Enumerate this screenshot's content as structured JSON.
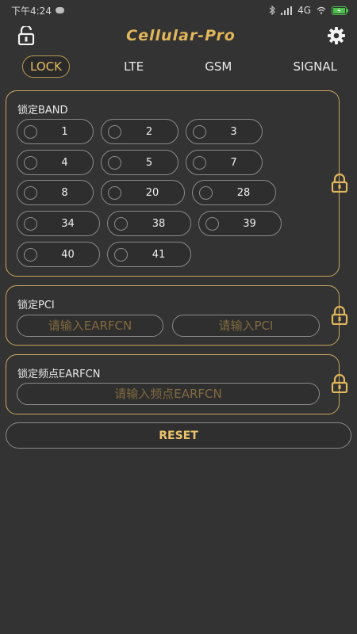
{
  "status_bar": {
    "time": "下午4:24",
    "network": "4G"
  },
  "app": {
    "title": "Cellular-Pro"
  },
  "tabs": [
    {
      "label": "LOCK",
      "active": true
    },
    {
      "label": "LTE",
      "active": false
    },
    {
      "label": "GSM",
      "active": false
    },
    {
      "label": "SIGNAL",
      "active": false
    }
  ],
  "band_section": {
    "title": "锁定BAND",
    "bands": [
      "1",
      "2",
      "3",
      "4",
      "5",
      "7",
      "8",
      "20",
      "28",
      "34",
      "38",
      "39",
      "40",
      "41"
    ]
  },
  "pci_section": {
    "title": "锁定PCI",
    "earfcn_placeholder": "请输入EARFCN",
    "pci_placeholder": "请输入PCI"
  },
  "earfcn_section": {
    "title": "锁定频点EARFCN",
    "placeholder": "请输入频点EARFCN"
  },
  "reset_label": "RESET",
  "colors": {
    "background": "#333333",
    "accent": "#e2b65a",
    "border": "#c9a85f"
  }
}
